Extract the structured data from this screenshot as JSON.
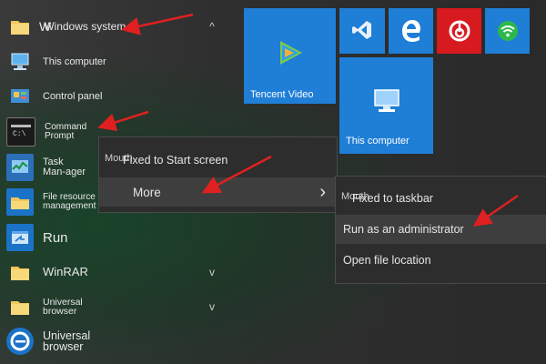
{
  "app_list": {
    "group_windows_system": {
      "label": "Windows system",
      "prefix_glyph": "W"
    },
    "this_computer": {
      "label": "This computer"
    },
    "control_panel": {
      "label": "Control panel"
    },
    "command_prompt": {
      "label": "Command Prompt"
    },
    "task_manager": {
      "label": "Task Man-ager"
    },
    "file_resource_management": {
      "label": "File resource management"
    },
    "run": {
      "label": "Run"
    },
    "winrar": {
      "label": "WinRAR"
    },
    "universal_browser_group": {
      "label": "Universal browser"
    },
    "universal_browser": {
      "label": "Universal browser"
    }
  },
  "tiles": {
    "tencent_video": {
      "label": "Tencent Video"
    },
    "this_computer": {
      "label": "This computer"
    }
  },
  "context_menu": {
    "ghost_prefix": "Mouth",
    "pin_start": "Fixed to Start screen",
    "more": "More",
    "more_chevron": "›"
  },
  "submenu": {
    "ghost_prefix": "Mouth",
    "pin_taskbar": "Fixed to taskbar",
    "run_as_admin": "Run as an administrator",
    "open_location": "Open file location"
  },
  "colors": {
    "tile_blue": "#1f7ed6",
    "netease_red": "#d71920",
    "annotation_red": "#e02020"
  },
  "icons": {
    "folder": "folder-icon",
    "computer": "computer-icon",
    "control_panel": "control-panel-icon",
    "cmd": "command-prompt-icon",
    "task_manager": "task-manager-icon",
    "explorer": "file-explorer-icon",
    "run": "run-icon",
    "edge": "edge-icon",
    "vscode": "visual-studio-icon",
    "netease": "netease-music-icon",
    "wifi": "wifi-icon",
    "tencent_video": "tencent-video-icon"
  }
}
